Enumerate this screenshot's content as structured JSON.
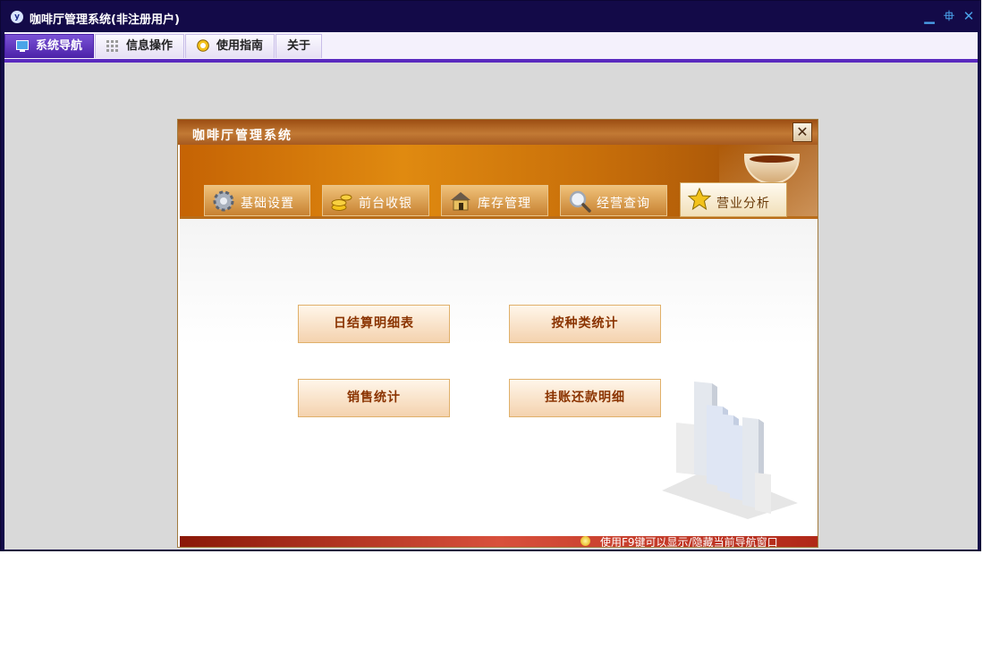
{
  "window": {
    "title": "咖啡厅管理系统(非注册用户)",
    "logo_text": "y",
    "minimize_glyph": "▁",
    "restore_glyph": "⯐",
    "close_glyph": "✕"
  },
  "menu": {
    "tabs": [
      {
        "label": "系统导航",
        "icon": "monitor-icon",
        "active": true
      },
      {
        "label": "信息操作",
        "icon": "grid-icon",
        "active": false
      },
      {
        "label": "使用指南",
        "icon": "compass-icon",
        "active": false
      },
      {
        "label": "关于",
        "icon": "",
        "active": false
      }
    ]
  },
  "dialog": {
    "title": "咖啡厅管理系统",
    "close_glyph": "✕",
    "nav_tabs": [
      {
        "label": "基础设置",
        "icon": "gear-icon",
        "active": false
      },
      {
        "label": "前台收银",
        "icon": "coins-icon",
        "active": false
      },
      {
        "label": "库存管理",
        "icon": "warehouse-icon",
        "active": false
      },
      {
        "label": "经营查询",
        "icon": "magnifier-icon",
        "active": false
      },
      {
        "label": "营业分析",
        "icon": "star-icon",
        "active": true
      }
    ],
    "buttons": [
      {
        "label": "日结算明细表"
      },
      {
        "label": "按种类统计"
      },
      {
        "label": "销售统计"
      },
      {
        "label": "挂账还款明细"
      }
    ],
    "status_text": "使用F9键可以显示/隐藏当前导航窗口"
  },
  "colors": {
    "window_frame": "#130a48",
    "menu_accent": "#5a2abf",
    "dialog_title": "#a65a20",
    "banner": "#e08a10",
    "button_text": "#8a3300",
    "status_bar": "#d8503c"
  }
}
